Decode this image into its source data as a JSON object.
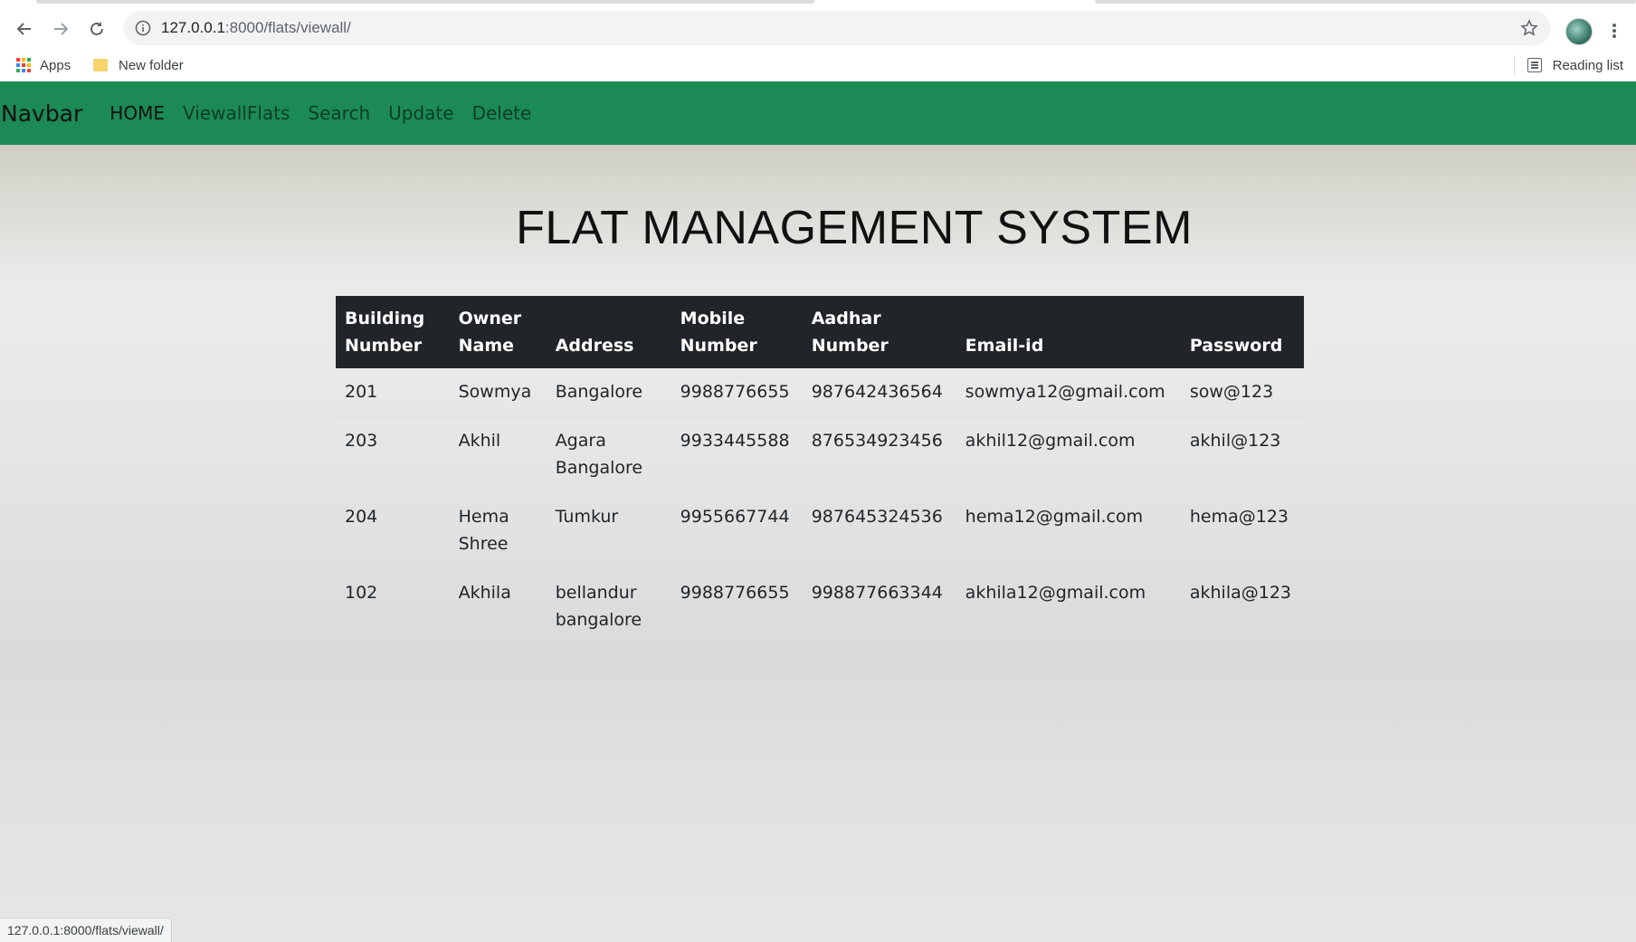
{
  "browser": {
    "url_host": "127.0.0.1",
    "url_rest": ":8000/flats/viewall/",
    "bookmarks": [
      {
        "label": "Apps",
        "icon": "apps-grid-icon"
      },
      {
        "label": "New folder",
        "icon": "folder-icon"
      }
    ],
    "reading_list_label": "Reading list",
    "status_url": "127.0.0.1:8000/flats/viewall/"
  },
  "navbar": {
    "brand": "Navbar",
    "links": [
      "HOME",
      "ViewallFlats",
      "Search",
      "Update",
      "Delete"
    ],
    "bg_color": "#1b8a55"
  },
  "page": {
    "title": "FLAT MANAGEMENT SYSTEM"
  },
  "table": {
    "headers": [
      [
        "Building",
        "Number"
      ],
      [
        "Owner",
        "Name"
      ],
      [
        "Address"
      ],
      [
        "Mobile",
        "Number"
      ],
      [
        "Aadhar",
        "Number"
      ],
      [
        "Email-id"
      ],
      [
        "Password"
      ]
    ],
    "rows": [
      [
        "201",
        "Sowmya",
        "Bangalore",
        "9988776655",
        "987642436564",
        "sowmya12@gmail.com",
        "sow@123"
      ],
      [
        "203",
        "Akhil",
        "Agara Bangalore",
        "9933445588",
        "876534923456",
        "akhil12@gmail.com",
        "akhil@123"
      ],
      [
        "204",
        "Hema Shree",
        "Tumkur",
        "9955667744",
        "987645324536",
        "hema12@gmail.com",
        "hema@123"
      ],
      [
        "102",
        "Akhila",
        "bellandur bangalore",
        "9988776655",
        "998877663344",
        "akhila12@gmail.com",
        "akhila@123"
      ]
    ]
  }
}
